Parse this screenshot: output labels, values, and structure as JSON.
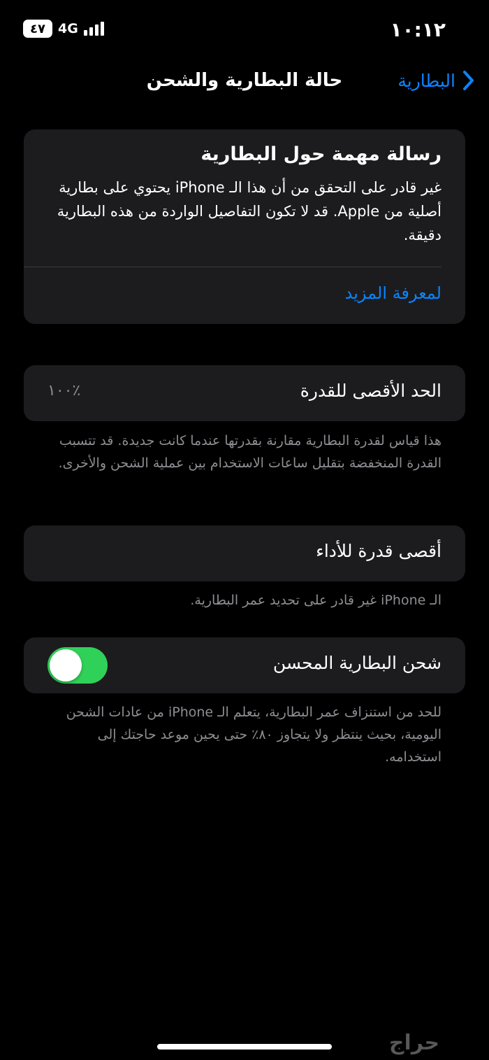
{
  "status_bar": {
    "time": "١٠:١٢",
    "battery": "٤٧",
    "network": "4G"
  },
  "nav": {
    "title": "حالة البطارية والشحن",
    "back_label": "البطارية"
  },
  "message_card": {
    "title": "رسالة مهمة حول البطارية",
    "body": "غير قادر على التحقق من أن هذا الـ iPhone يحتوي على بطارية أصلية من Apple. قد لا تكون التفاصيل الواردة من هذه البطارية دقيقة.",
    "link": "لمعرفة المزيد"
  },
  "max_capacity": {
    "label": "الحد الأقصى للقدرة",
    "value": "٪١٠٠",
    "footnote": "هذا قياس لقدرة البطارية مقارنة بقدرتها عندما كانت جديدة. قد تتسبب القدرة المنخفضة بتقليل ساعات الاستخدام بين عملية الشحن والأخرى."
  },
  "peak_performance": {
    "label": "أقصى قدرة للأداء",
    "footnote": "الـ iPhone غير قادر على تحديد عمر البطارية."
  },
  "optimized_charging": {
    "label": "شحن البطارية المحسن",
    "enabled": true,
    "footnote": "للحد من استنزاف عمر البطارية، يتعلم الـ iPhone من عادات الشحن اليومية، بحيث ينتظر ولا يتجاوز ٨٠٪ حتى يحين موعد حاجتك إلى استخدامه."
  },
  "watermark": {
    "text": "حراج"
  },
  "colors": {
    "background": "#000000",
    "card": "#1c1c1e",
    "accent": "#0a84ff",
    "toggle_on": "#30d158",
    "secondary_text": "#8e8e93"
  }
}
